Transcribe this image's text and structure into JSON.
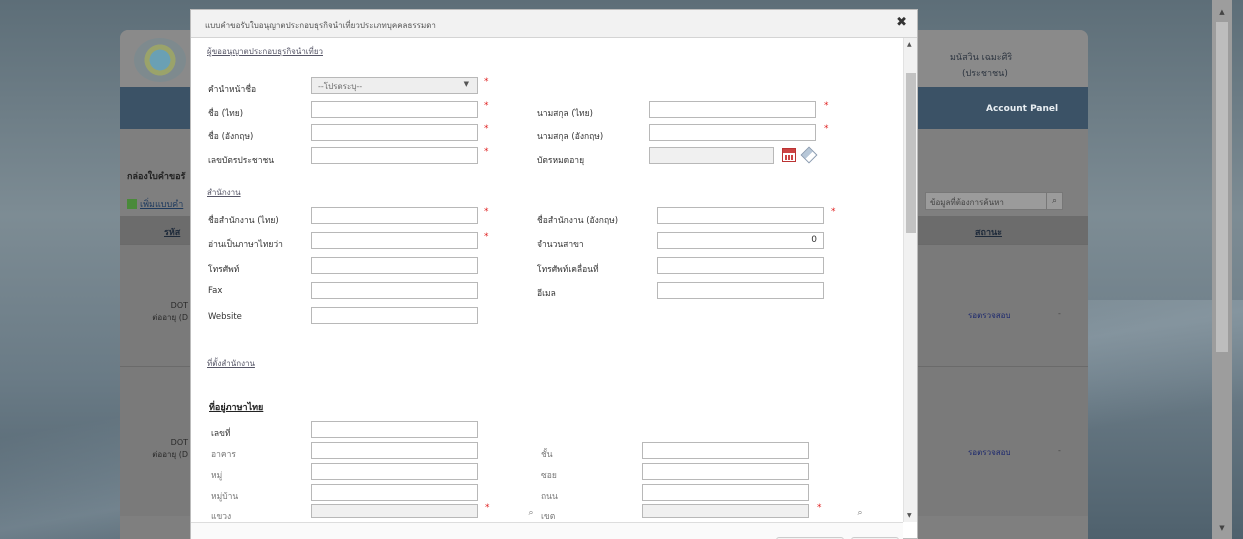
{
  "background": {
    "user_name": "มนัสวิน เฉมะศิริ",
    "user_role": "(ประชาชน)",
    "account_panel": "Account Panel",
    "sidebar_title": "กล่องใบคำขอรั",
    "add_link": "เพิ่มแบบคำ",
    "search_placeholder": "ข้อมูลที่ต้องการค้นหา",
    "col_left": "รหัส",
    "col_status": "สถานะ",
    "rows": [
      {
        "code": "DOT",
        "sub": "ต่ออายุ (D",
        "status": "รอตรวจสอบ",
        "dash": "-"
      },
      {
        "code": "DOT",
        "sub": "ต่ออายุ (D",
        "status": "รอตรวจสอบ",
        "dash": "-"
      }
    ]
  },
  "modal": {
    "title": "แบบคำขอรับใบอนุญาตประกอบธุรกิจนำเที่ยวประเภทบุคคลธรรมดา",
    "close_icon": "x-icon",
    "section_applicant": "ผู้ขออนุญาตประกอบธุรกิจนำเที่ยว",
    "section_office": "สำนักงาน",
    "section_address": "ที่ตั้งสำนักงาน",
    "section_thai_address": "ที่อยู่ภาษาไทย",
    "fields": {
      "prefix_label": "คำนำหน้าชื่อ",
      "prefix_value": "--โปรดระบุ--",
      "first_th": "ชื่อ (ไทย)",
      "last_th": "นามสกุล (ไทย)",
      "first_en": "ชื่อ (อังกฤษ)",
      "last_en": "นามสกุล (อังกฤษ)",
      "id_card": "เลขบัตรประชาชน",
      "expire": "บัตรหมดอายุ",
      "office_th": "ชื่อสำนักงาน (ไทย)",
      "office_en": "ชื่อสำนักงาน (อังกฤษ)",
      "reading": "อ่านเป็นภาษาไทยว่า",
      "branch_count": "จำนวนสาขา",
      "branch_count_value": "0",
      "phone": "โทรศัพท์",
      "mobile": "โทรศัพท์เคลื่อนที่",
      "fax": "Fax",
      "email": "อีเมล",
      "website": "Website",
      "house_no": "เลขที่",
      "building": "อาคาร",
      "floor": "ชั้น",
      "moo": "หมู่",
      "soi": "ซอย",
      "village": "หมู่บ้าน",
      "road": "ถนน",
      "subdistrict": "แขวง",
      "district": "เขต"
    },
    "required_mark": "*"
  }
}
